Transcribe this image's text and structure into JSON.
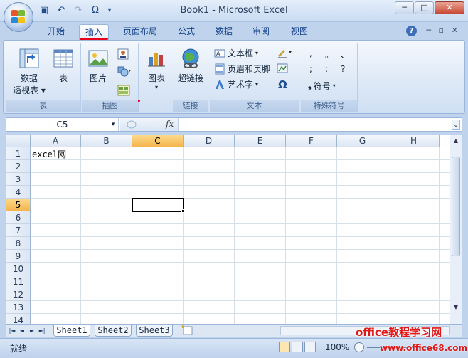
{
  "window": {
    "title": "Book1 - Microsoft Excel",
    "controls": {
      "minimize": "─",
      "maximize": "□",
      "close": "✕"
    }
  },
  "qat": {
    "save_icon": "save-icon",
    "undo_icon": "undo-icon",
    "redo_icon": "redo-icon",
    "omega": "Ω",
    "more": "▾"
  },
  "tabs": [
    {
      "label": "开始"
    },
    {
      "label": "插入",
      "active": true
    },
    {
      "label": "页面布局"
    },
    {
      "label": "公式"
    },
    {
      "label": "数据"
    },
    {
      "label": "审阅"
    },
    {
      "label": "视图"
    }
  ],
  "ribbon": {
    "groups": {
      "table": {
        "label": "表",
        "pivot_line1": "数据",
        "pivot_line2": "透视表",
        "table_btn": "表"
      },
      "illustrations": {
        "label": "插图",
        "picture_btn": "图片"
      },
      "charts": {
        "chart_btn": "图表"
      },
      "links": {
        "label": "链接",
        "hyperlink_btn": "超链接"
      },
      "text": {
        "label": "文本",
        "textbox": "文本框",
        "header_footer": "页眉和页脚",
        "wordart": "艺术字",
        "omega": "Ω"
      },
      "special": {
        "label": "特殊符号",
        "symbols_row1": [
          ",",
          "。",
          "、"
        ],
        "symbols_row2": [
          ";",
          ":",
          "?"
        ],
        "symbol_btn": "符号"
      }
    }
  },
  "formula_bar": {
    "name_box": "C5",
    "fx": "fx",
    "dropdown": "▾"
  },
  "grid": {
    "columns": [
      "A",
      "B",
      "C",
      "D",
      "E",
      "F",
      "G",
      "H"
    ],
    "rows": [
      "1",
      "2",
      "3",
      "4",
      "5",
      "6",
      "7",
      "8",
      "9",
      "10",
      "11",
      "12",
      "13",
      "14"
    ],
    "selected_column": "C",
    "selected_row": "5",
    "cells": {
      "A1": "excel网"
    }
  },
  "sheets": [
    {
      "name": "Sheet1",
      "active": true
    },
    {
      "name": "Sheet2"
    },
    {
      "name": "Sheet3"
    }
  ],
  "sheet_nav": [
    "|◄",
    "◄",
    "►",
    "►|"
  ],
  "status": {
    "ready": "就绪",
    "zoom": "100%",
    "zoom_minus": "−"
  },
  "watermark": {
    "line1": "office教程学习网",
    "line2": "www.office68.com"
  },
  "colors": {
    "accent": "#15428b",
    "highlight": "#f5b54c",
    "red_mark": "#e8001c"
  }
}
